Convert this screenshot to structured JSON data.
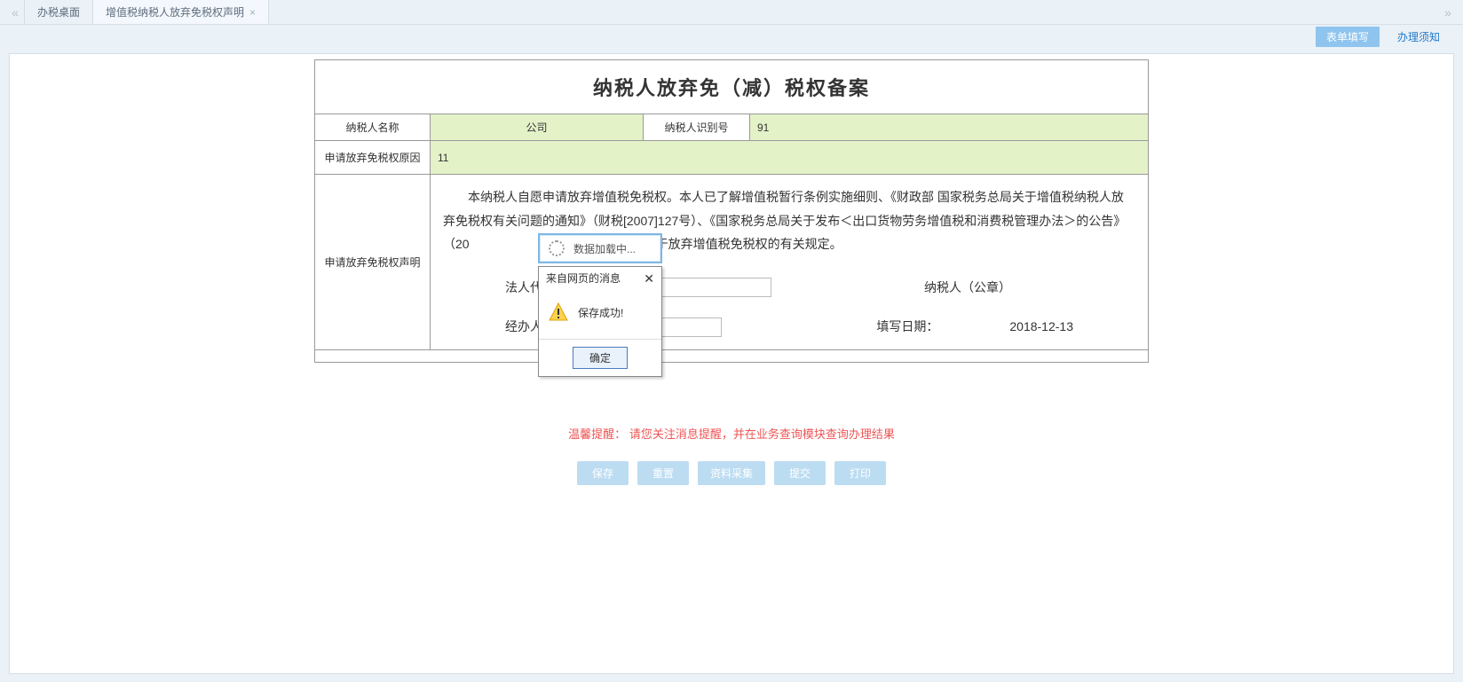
{
  "tabs": {
    "items": [
      {
        "label": "办税桌面",
        "closable": false
      },
      {
        "label": "增值税纳税人放弃免税权声明",
        "closable": true
      }
    ],
    "activeIndex": 1
  },
  "subbar": {
    "form_fill": "表单填写",
    "instructions": "办理须知"
  },
  "form": {
    "title": "纳税人放弃免（减）税权备案",
    "labels": {
      "taxpayer_name": "纳税人名称",
      "taxpayer_id": "纳税人识别号",
      "reason": "申请放弃免税权原因",
      "statement": "申请放弃免税权声明",
      "legal_rep": "法人代表（签字）",
      "handler": "经办人：",
      "taxpayer_seal": "纳税人（公章）",
      "fill_date": "填写日期："
    },
    "values": {
      "taxpayer_name": "公司",
      "taxpayer_id": "91",
      "reason": "11",
      "statement": "　　本纳税人自愿申请放弃增值税免税权。本人已了解增值税暂行条例实施细则、《财政部 国家税务总局关于增值税纳税人放弃免税权有关问题的通知》（财税[2007]127号）、《国家税务总局关于发布＜出口货物劳务增值税和消费税管理办法＞的公告》（20　　　　　　　　　　　　　　关于放弃增值税免税权的有关规定。",
      "legal_rep": "",
      "handler": "",
      "fill_date": "2018-12-13"
    }
  },
  "reminder": {
    "label": "温馨提醒：",
    "text": " 请您关注消息提醒，并在业务查询模块查询办理结果"
  },
  "actions": {
    "save": "保存",
    "reset": "重置",
    "collect": "资料采集",
    "submit": "提交",
    "print": "打印"
  },
  "loading": {
    "text": "数据加载中..."
  },
  "dialog": {
    "title": "来自网页的消息",
    "message": "保存成功!",
    "ok": "确定"
  }
}
